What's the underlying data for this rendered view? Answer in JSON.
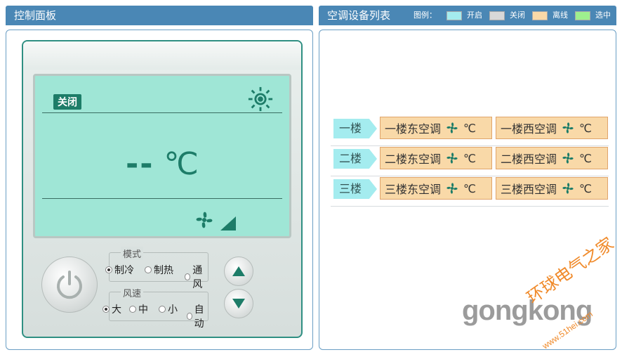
{
  "left_panel": {
    "title": "控制面板",
    "lcd": {
      "status": "关闭",
      "temp_value": "--",
      "temp_unit": "℃",
      "mode_icon": "sun-icon",
      "fan_icon": "fan-icon",
      "speed_icon": "fan-speed-icon"
    },
    "mode": {
      "title": "模式",
      "options": [
        "制冷",
        "制热",
        "通风"
      ],
      "selected": "制冷"
    },
    "speed": {
      "title": "风速",
      "options": [
        "大",
        "中",
        "小",
        "自动"
      ],
      "selected": "大"
    }
  },
  "right_panel": {
    "title": "空调设备列表",
    "legend": {
      "title": "图例：",
      "items": [
        {
          "label": "开启",
          "color": "#a4ecef"
        },
        {
          "label": "关闭",
          "color": "#d8d8d8"
        },
        {
          "label": "离线",
          "color": "#f9d9a8"
        },
        {
          "label": "选中",
          "color": "#9ef08e"
        }
      ]
    },
    "floors": [
      {
        "label": "一楼",
        "units": [
          {
            "name": "一楼东空调",
            "unit": "℃"
          },
          {
            "name": "一楼西空调",
            "unit": "℃"
          }
        ]
      },
      {
        "label": "二楼",
        "units": [
          {
            "name": "二楼东空调",
            "unit": "℃"
          },
          {
            "name": "二楼西空调",
            "unit": "℃"
          }
        ]
      },
      {
        "label": "三楼",
        "units": [
          {
            "name": "三楼东空调",
            "unit": "℃"
          },
          {
            "name": "三楼西空调",
            "unit": "℃"
          }
        ]
      }
    ]
  },
  "watermark": {
    "brand": "gongkong",
    "cn": "环球电气之家",
    "url": "www.51hei.com"
  },
  "colors": {
    "header": "#4a87b5",
    "lcd": "#9fe6d6",
    "lcd_ink": "#1d7c68",
    "floor_tag": "#a4ecef",
    "offline_card": "#f9d9a8"
  }
}
